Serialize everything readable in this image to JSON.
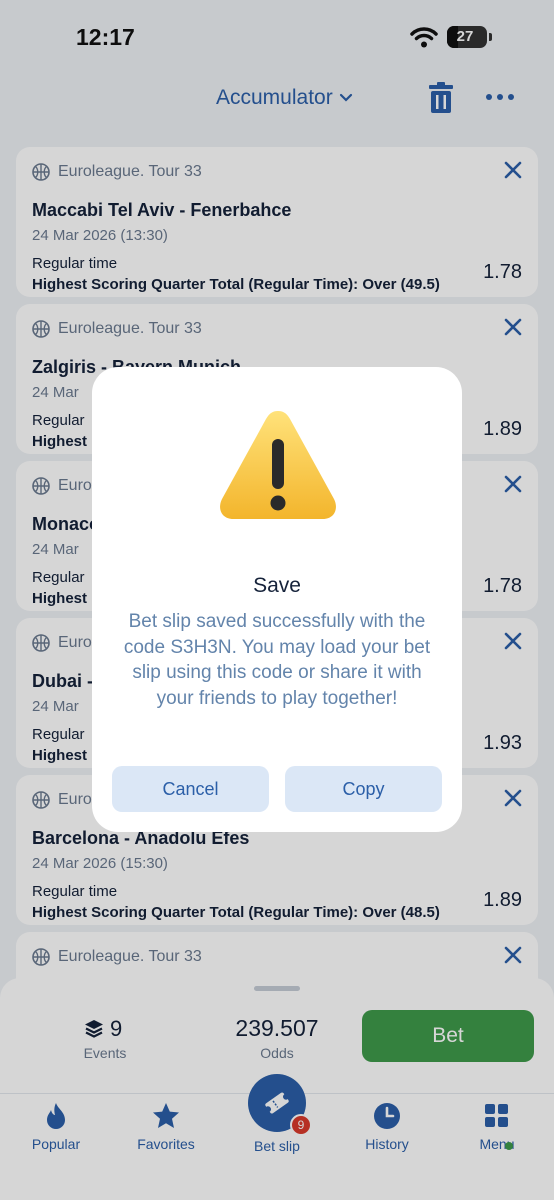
{
  "status_bar": {
    "time": "12:17",
    "battery": "27",
    "battery_level": 0.27
  },
  "header": {
    "title": "Accumulator",
    "icons": [
      "chevron-down-icon",
      "trash-icon",
      "more-icon"
    ]
  },
  "bets": [
    {
      "league": "Euroleague. Tour 33",
      "teams": "Maccabi Tel Aviv - Fenerbahce",
      "date": "24 Mar 2026 (13:30)",
      "market": "Regular time",
      "selection": "Highest Scoring Quarter Total (Regular Time): Over (49.5)",
      "odds": "1.78"
    },
    {
      "league": "Euroleague. Tour 33",
      "teams": "Zalgiris - Bayern Munich",
      "date": "24 Mar",
      "market": "Regular",
      "selection": "Highest",
      "odds": "1.89"
    },
    {
      "league": "Euro",
      "teams": "Monaco",
      "date": "24 Mar",
      "market": "Regular",
      "selection": "Highest",
      "odds": "1.78"
    },
    {
      "league": "Euro",
      "teams": "Dubai -",
      "date": "24 Mar",
      "market": "Regular",
      "selection": "Highest",
      "odds": "1.93"
    },
    {
      "league": "Euro",
      "teams": "Barcelona - Anadolu Efes",
      "date": "24 Mar 2026 (15:30)",
      "market": "Regular time",
      "selection": "Highest Scoring Quarter Total (Regular Time): Over (48.5)",
      "odds": "1.89"
    },
    {
      "league": "Euroleague. Tour 33",
      "teams": "",
      "date": "",
      "market": "",
      "selection": "",
      "odds": ""
    }
  ],
  "summary": {
    "events_count": "9",
    "events_label": "Events",
    "total_odds": "239.507",
    "odds_label": "Odds",
    "bet_label": "Bet"
  },
  "tabs": [
    {
      "label": "Popular",
      "icon": "flame-icon"
    },
    {
      "label": "Favorites",
      "icon": "star-icon"
    },
    {
      "label": "Bet slip",
      "icon": "ticket-icon",
      "badge": "9"
    },
    {
      "label": "History",
      "icon": "clock-icon"
    },
    {
      "label": "Menu",
      "icon": "grid-icon"
    }
  ],
  "dialog": {
    "title": "Save",
    "message": "Bet slip saved successfully with the code S3H3N. You may load your bet slip using this code or share it with your friends to play together!",
    "cancel_label": "Cancel",
    "copy_label": "Copy"
  },
  "colors": {
    "accent": "#2b5fa8",
    "bet_green": "#3f9a4a",
    "badge_red": "#d93a2b",
    "warning_yellow": "#f7c744"
  }
}
